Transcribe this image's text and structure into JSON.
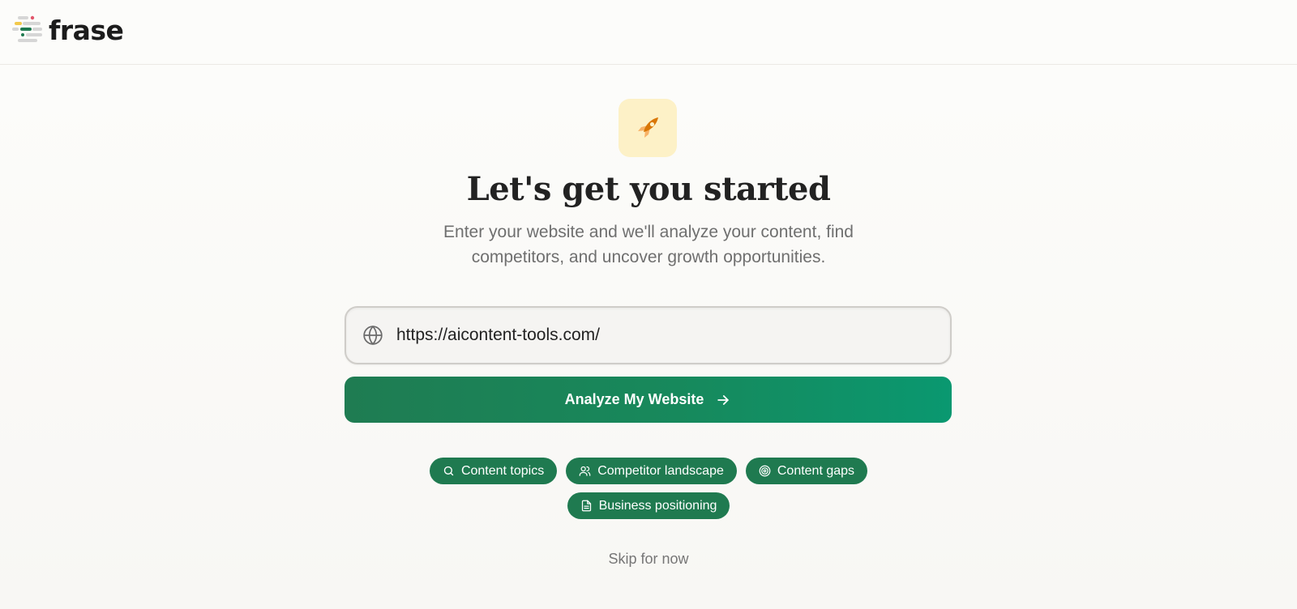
{
  "brand": {
    "name": "frase"
  },
  "hero": {
    "title": "Let's get you started",
    "subtitle": "Enter your website and we'll analyze your content, find competitors, and uncover growth opportunities."
  },
  "url_field": {
    "value": "https://aicontent-tools.com/",
    "icon": "globe-icon"
  },
  "analyze_button": {
    "label": "Analyze My Website",
    "icon": "arrow-right-icon"
  },
  "chips": [
    {
      "label": "Content topics",
      "icon": "search-icon"
    },
    {
      "label": "Competitor landscape",
      "icon": "users-icon"
    },
    {
      "label": "Content gaps",
      "icon": "target-icon"
    },
    {
      "label": "Business positioning",
      "icon": "document-icon"
    }
  ],
  "skip_link": {
    "label": "Skip for now"
  },
  "colors": {
    "primary_green": "#1f7a50",
    "button_gradient_end": "#0a9870",
    "rocket_tile": "#fdf1c7",
    "rocket": "#d97706"
  }
}
